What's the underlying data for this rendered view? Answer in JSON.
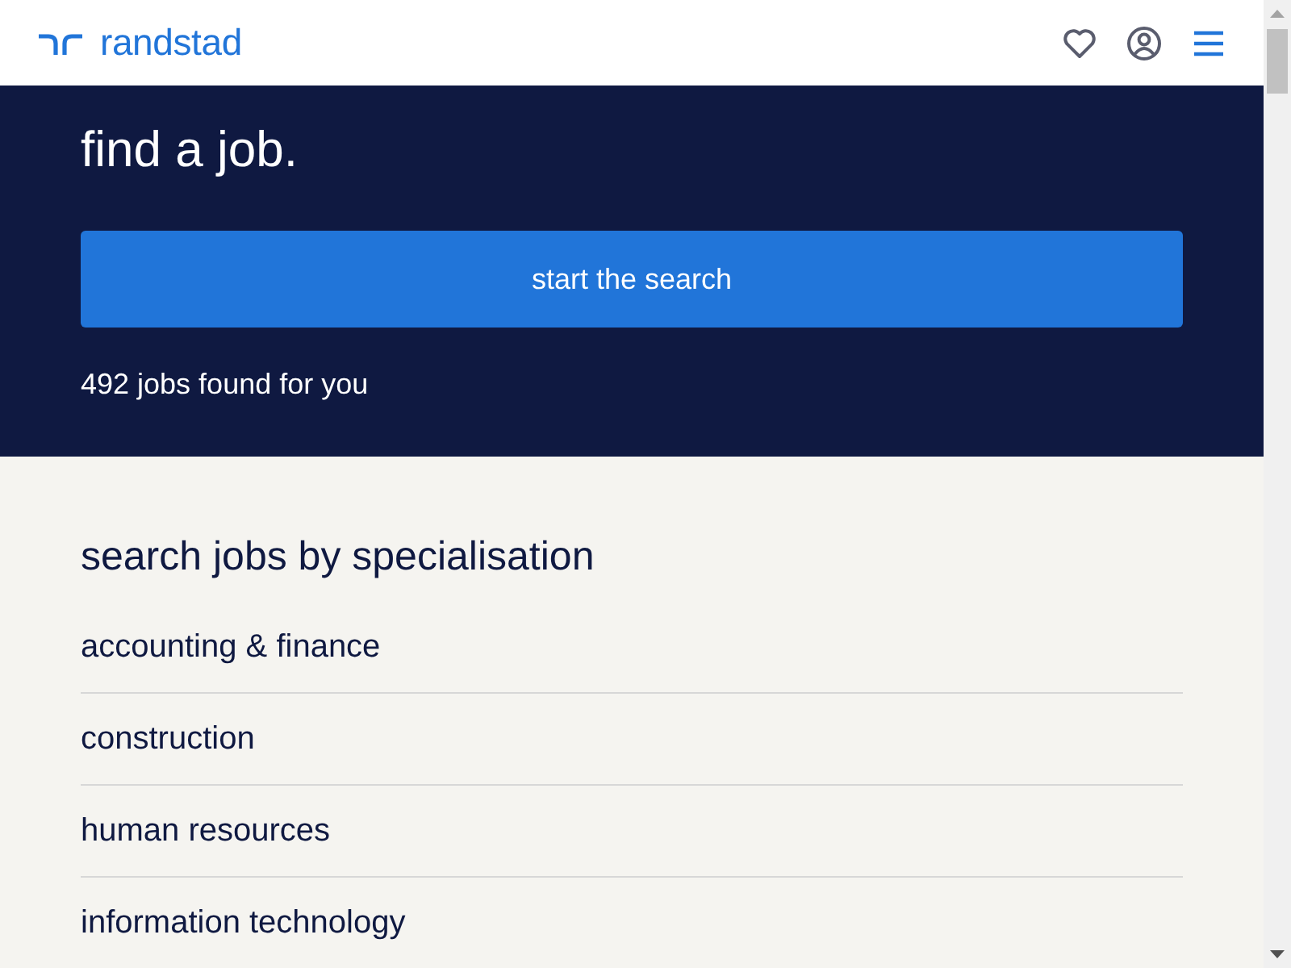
{
  "header": {
    "logo": "randstad"
  },
  "hero": {
    "title": "find a job.",
    "search_button": "start the search",
    "result_count": "492 jobs found for you"
  },
  "specialisations": {
    "heading": "search jobs by specialisation",
    "items": [
      "accounting & finance",
      "construction",
      "human resources",
      "information technology"
    ]
  }
}
